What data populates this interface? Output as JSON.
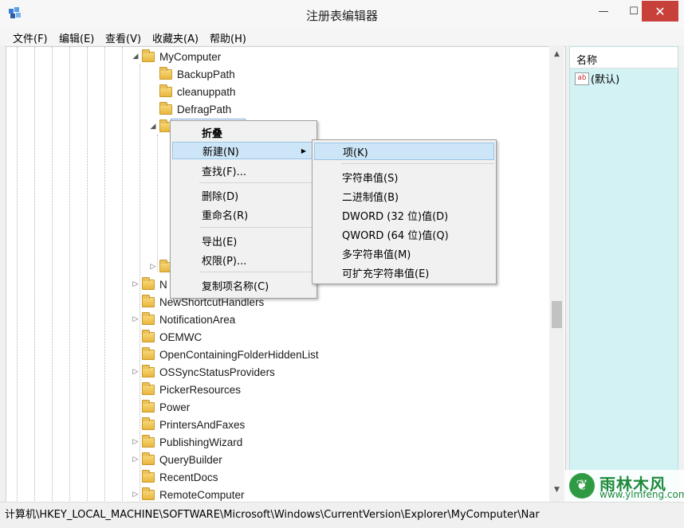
{
  "window": {
    "title": "注册表编辑器",
    "minimize": "—",
    "maximize": "☐",
    "close": "✕"
  },
  "menu": [
    "文件(F)",
    "编辑(E)",
    "查看(V)",
    "收藏夹(A)",
    "帮助(H)"
  ],
  "tree": {
    "parent": "MyComputer",
    "children": [
      "BackupPath",
      "cleanuppath",
      "DefragPath"
    ],
    "rename_value": "",
    "after": [
      "N",
      "NewShortcutHandlers",
      "NotificationArea",
      "OEMWC",
      "OpenContainingFolderHiddenList",
      "OSSyncStatusProviders",
      "PickerResources",
      "Power",
      "PrintersAndFaxes",
      "PublishingWizard",
      "QueryBuilder",
      "RecentDocs",
      "RemoteComputer"
    ]
  },
  "context_menu": {
    "items": [
      "折叠",
      "新建(N)",
      "查找(F)...",
      "删除(D)",
      "重命名(R)",
      "导出(E)",
      "权限(P)...",
      "复制项名称(C)"
    ]
  },
  "submenu": {
    "items": [
      "项(K)",
      "字符串值(S)",
      "二进制值(B)",
      "DWORD (32 位)值(D)",
      "QWORD (64 位)值(Q)",
      "多字符串值(M)",
      "可扩充字符串值(E)"
    ]
  },
  "right_pane": {
    "column_name": "名称",
    "default_value": "(默认)",
    "value_icon_text": "ab"
  },
  "status_bar": {
    "path": "计算机\\HKEY_LOCAL_MACHINE\\SOFTWARE\\Microsoft\\Windows\\CurrentVersion\\Explorer\\MyComputer\\Nar"
  },
  "watermark": {
    "cn": "雨林木风",
    "en": "www.ylmfeng.com"
  }
}
